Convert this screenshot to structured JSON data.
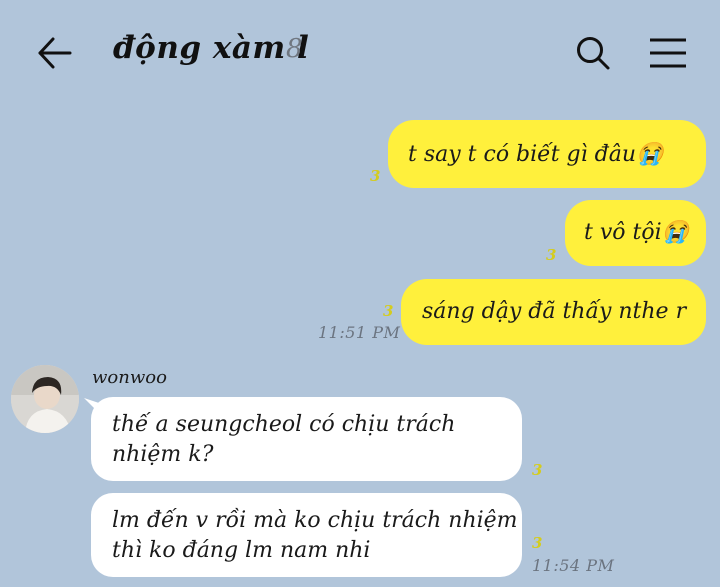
{
  "header": {
    "title": "động xàm l",
    "member_count": "8",
    "back_icon": "arrow-left-icon",
    "search_icon": "search-icon",
    "menu_icon": "hamburger-menu-icon"
  },
  "messages": {
    "m1": {
      "text": "t say t có biết gì đâu😭",
      "read": "3"
    },
    "m2": {
      "text": "t vô tội😭",
      "read": "3"
    },
    "m3": {
      "text": "sáng dậy đã thấy nthe r",
      "read": "3",
      "time": "11:51 PM"
    },
    "sender": "wonwoo",
    "m4": {
      "line1": "thế a seungcheol có chịu trách",
      "line2": "nhiệm k?",
      "read": "3"
    },
    "m5": {
      "line1": "lm đến v rồi mà ko chịu trách nhiệm",
      "line2": "thì ko đáng lm nam nhi",
      "read": "3",
      "time": "11:54 PM"
    }
  },
  "colors": {
    "background": "#b1c5da",
    "outgoing_bubble": "#fff03c",
    "incoming_bubble": "#ffffff",
    "read_count": "#d4cc1e",
    "timestamp": "#6b7480"
  }
}
